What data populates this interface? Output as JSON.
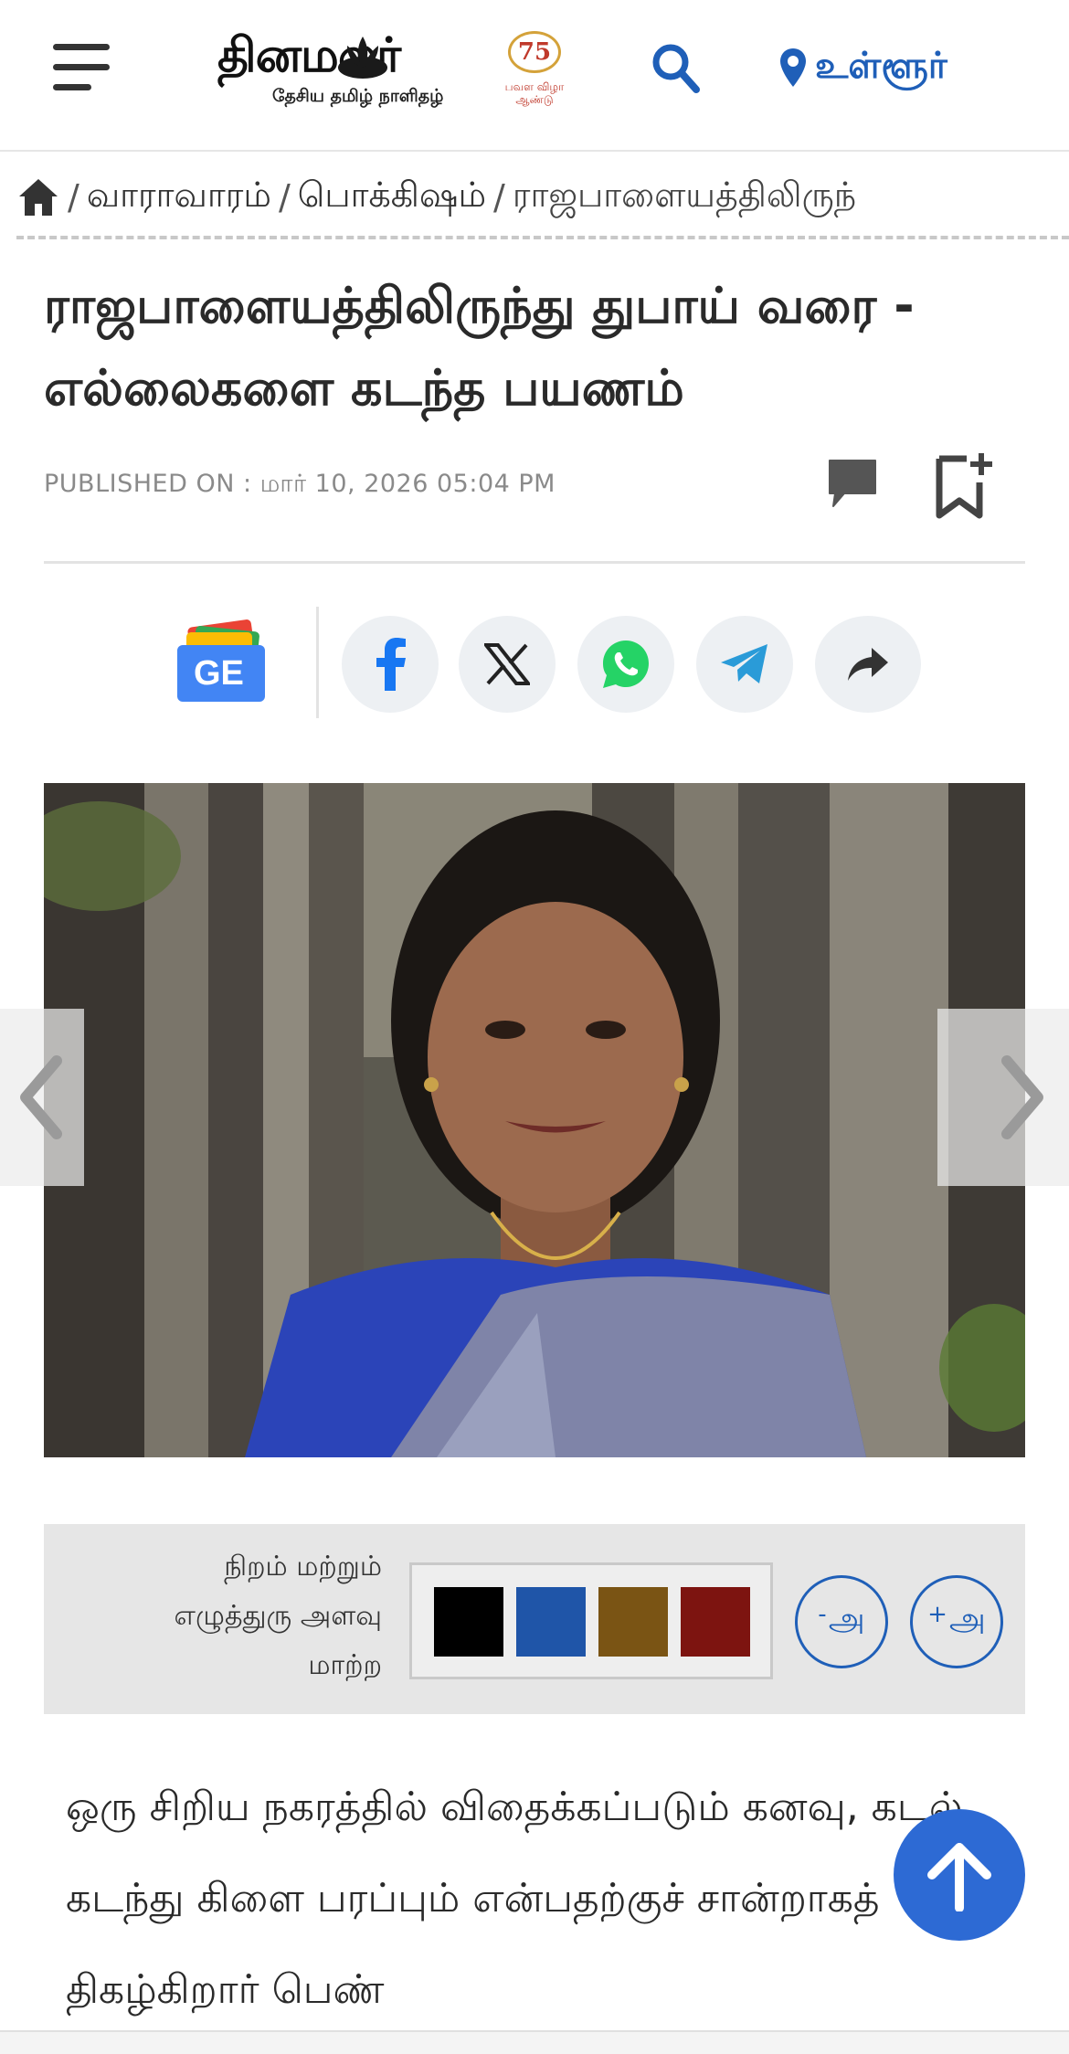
{
  "header": {
    "logo_text": "தினமலர்",
    "logo_subtitle": "தேசிய தமிழ் நாளிதழ்",
    "anniversary_number": "75",
    "anniversary_sub": "பவள விழா ஆண்டு",
    "location_label": "உள்ளூர்",
    "icons": {
      "menu": "hamburger-icon",
      "search": "search-icon",
      "location": "location-pin-icon"
    }
  },
  "breadcrumb": {
    "items": [
      "வாராவாரம்",
      "பொக்கிஷம்",
      "ராஜபாளையத்திலிருந்"
    ],
    "home_icon": "home-icon"
  },
  "article": {
    "title": "ராஜபாளையத்திலிருந்து துபாய் வரை - எல்லைகளை கடந்த பயணம்",
    "published": "PUBLISHED ON : மார் 10, 2026 05:04 PM",
    "body": "ஒரு சிறிய நகரத்தில் விதைக்கப்படும் கனவு, கடல் கடந்து கிளை பரப்பும் என்பதற்குச் சான்றாகத் திகழ்கிறார் பெண்"
  },
  "share": {
    "google_news_badge": "GE",
    "buttons": [
      "facebook-icon",
      "x-icon",
      "whatsapp-icon",
      "telegram-icon",
      "share-forward-icon"
    ]
  },
  "font_controls": {
    "label": "நிறம் மற்றும் எழுத்துரு அளவு மாற்ற",
    "swatches": [
      "#000000",
      "#1f55a8",
      "#7a5414",
      "#7d1410"
    ],
    "decrease_label": "அ",
    "decrease_sign": "-",
    "increase_label": "அ",
    "increase_sign": "+"
  },
  "colors": {
    "accent": "#1f5fb8",
    "scroll_top": "#2d6ad4"
  }
}
